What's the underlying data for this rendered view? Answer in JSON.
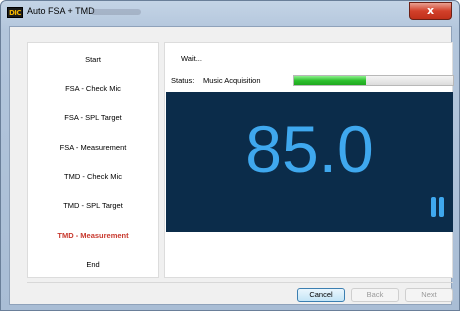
{
  "window": {
    "title": "Auto FSA + TMD",
    "app_icon_text": "DIC",
    "close_label": "x"
  },
  "steps": [
    {
      "label": "Start",
      "active": false
    },
    {
      "label": "FSA - Check Mic",
      "active": false
    },
    {
      "label": "FSA - SPL Target",
      "active": false
    },
    {
      "label": "FSA - Measurement",
      "active": false
    },
    {
      "label": "TMD - Check Mic",
      "active": false
    },
    {
      "label": "TMD - SPL Target",
      "active": false
    },
    {
      "label": "TMD - Measurement",
      "active": true
    },
    {
      "label": "End",
      "active": false
    }
  ],
  "main": {
    "wait_text": "Wait...",
    "status_label": "Status:",
    "status_value": "Music Acquisition",
    "progress_fraction": 0.45,
    "reading": "85.0"
  },
  "buttons": {
    "cancel": "Cancel",
    "back": "Back",
    "next": "Next"
  },
  "colors": {
    "display_bg": "#0b2c4a",
    "reading": "#3fa8ee",
    "active_step": "#c8392e",
    "progress": "#2fc02f"
  }
}
